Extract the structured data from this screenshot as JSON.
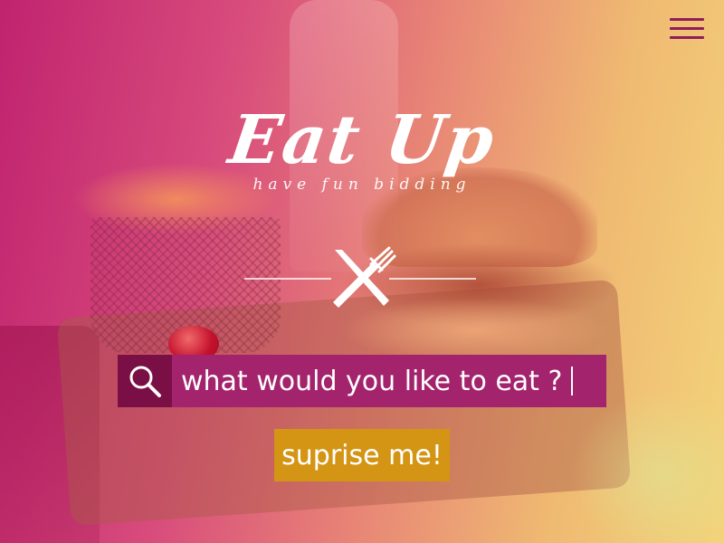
{
  "header": {
    "menu_icon": "hamburger-menu-icon",
    "menu_color": "#8e1d5a"
  },
  "logo": {
    "title": "Eat Up",
    "tagline": "have fun bidding",
    "emblem_icon": "crossed-knife-fork-icon"
  },
  "search": {
    "icon": "search-icon",
    "value": "what would you like to eat ?",
    "icon_bg_color": "#7a0f45",
    "field_bg_color": "#a3236d"
  },
  "actions": {
    "surprise_label": "suprise me!",
    "surprise_color": "#d49515"
  }
}
